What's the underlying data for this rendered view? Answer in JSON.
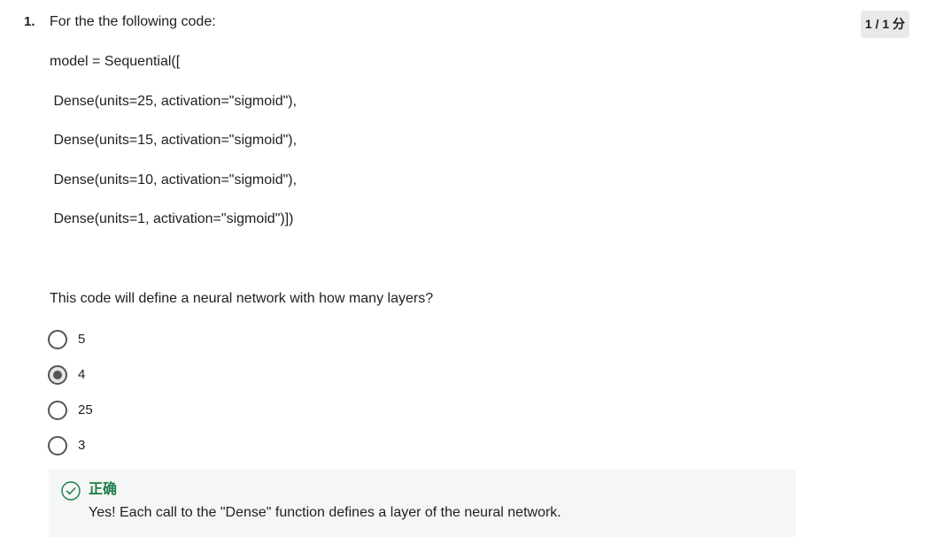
{
  "question": {
    "number": "1.",
    "text": "For the the following code:",
    "score": "1 / 1 分",
    "code_lines": [
      "model = Sequential([",
      " Dense(units=25, activation=\"sigmoid\"),",
      " Dense(units=15, activation=\"sigmoid\"),",
      " Dense(units=10, activation=\"sigmoid\"),",
      " Dense(units=1, activation=\"sigmoid\")])"
    ],
    "prompt": "This code will define a neural network with how many layers?",
    "options": [
      {
        "label": "5",
        "selected": false
      },
      {
        "label": "4",
        "selected": true
      },
      {
        "label": "25",
        "selected": false
      },
      {
        "label": "3",
        "selected": false
      }
    ]
  },
  "feedback": {
    "status": "正确",
    "message": "Yes! Each call to the \"Dense\" function defines a layer of the neural network.",
    "icon": "check-circle-icon",
    "accent_color": "#1e7b4a"
  },
  "colors": {
    "radio_border": "#555555",
    "feedback_background": "#f4f7f5",
    "score_background": "#e9e9e9"
  }
}
